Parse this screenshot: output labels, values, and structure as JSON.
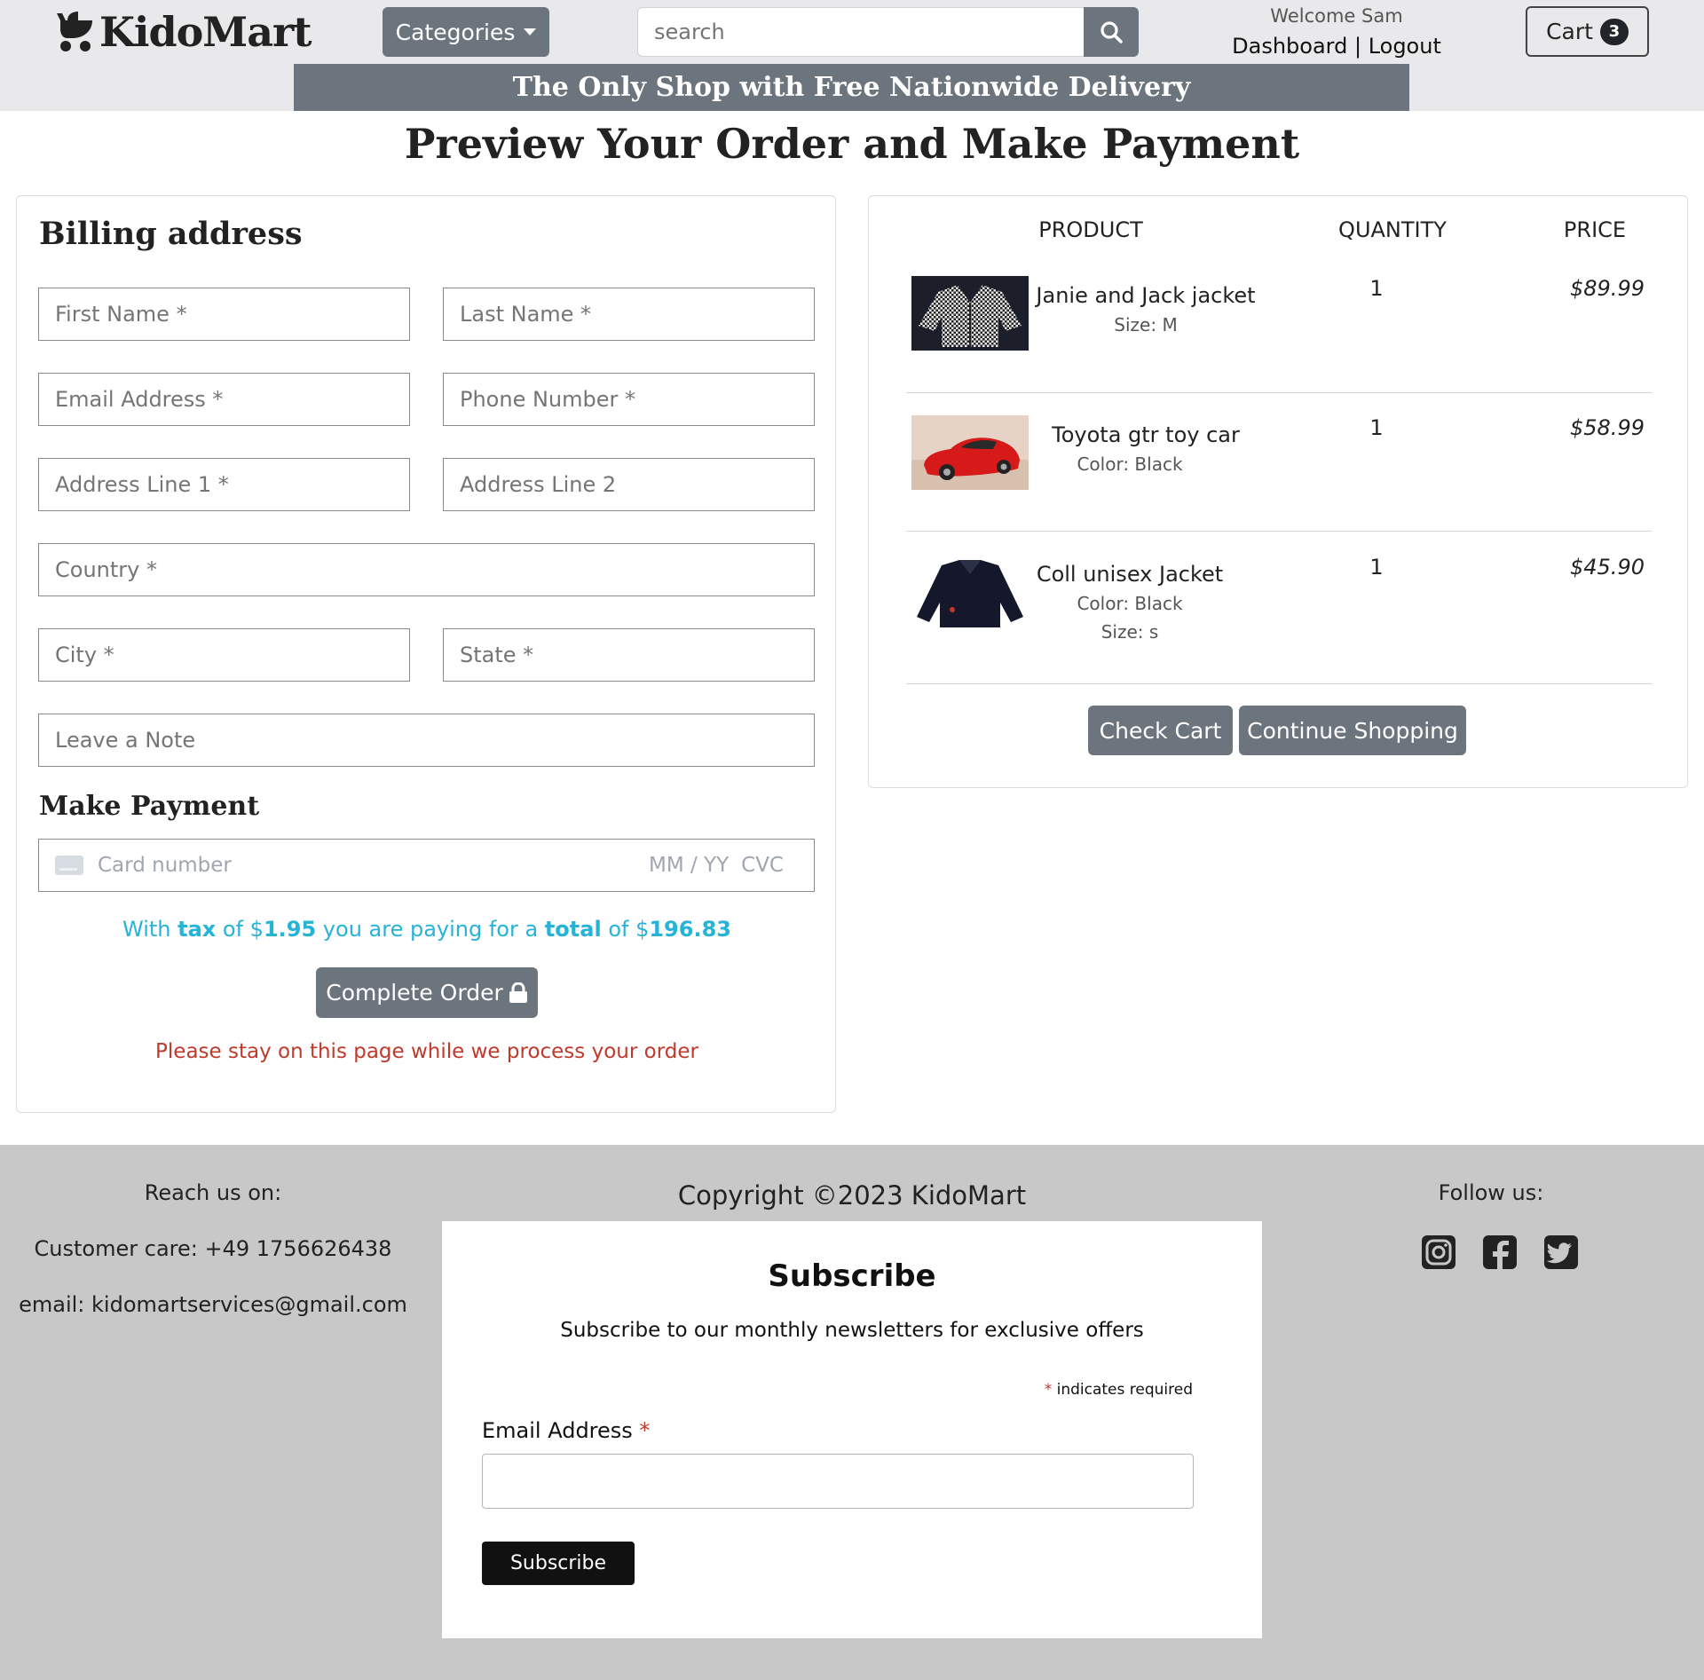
{
  "header": {
    "logo_text": "KidoMart",
    "categories_label": "Categories",
    "search_placeholder": "search",
    "welcome": "Welcome Sam",
    "dashboard_label": "Dashboard",
    "separator": " | ",
    "logout_label": "Logout",
    "cart_label": "Cart",
    "cart_count": "3",
    "banner": "The Only Shop with Free Nationwide Delivery"
  },
  "page_title": "Preview Your Order and Make Payment",
  "billing": {
    "title": "Billing address",
    "first_name": "First Name *",
    "last_name": "Last Name *",
    "email": "Email Address *",
    "phone": "Phone Number *",
    "address1": "Address Line 1 *",
    "address2": "Address Line 2",
    "country": "Country *",
    "city": "City *",
    "state": "State *",
    "note": "Leave a Note"
  },
  "payment": {
    "title": "Make Payment",
    "card_placeholder": "Card number",
    "exp_placeholder": "MM / YY",
    "cvc_placeholder": "CVC",
    "total_prefix": "With ",
    "tax_word": "tax",
    "tax_mid": " of $",
    "tax_amount": "1.95",
    "total_mid": " you are paying for a ",
    "total_word": "total",
    "total_mid2": " of $",
    "total_amount": "196.83",
    "complete_label": "Complete Order",
    "stay_message": "Please stay on this page while we process your order"
  },
  "cart": {
    "headers": {
      "product": "PRODUCT",
      "quantity": "QUANTITY",
      "price": "PRICE"
    },
    "items": [
      {
        "name": "Janie and Jack jacket",
        "attrs": [
          "Size: M"
        ],
        "qty": "1",
        "price": "$89.99"
      },
      {
        "name": "Toyota gtr toy car",
        "attrs": [
          "Color: Black"
        ],
        "qty": "1",
        "price": "$58.99"
      },
      {
        "name": "Coll unisex Jacket",
        "attrs": [
          "Color: Black",
          "Size: s"
        ],
        "qty": "1",
        "price": "$45.90"
      }
    ],
    "check_cart_label": "Check Cart",
    "continue_label": "Continue Shopping"
  },
  "footer": {
    "reach_us": "Reach us on:",
    "customer_care": "Customer care: +49 1756626438",
    "email": "email: kidomartservices@gmail.com",
    "copyright": "Copyright ©2023 KidoMart",
    "follow_us": "Follow us:",
    "subscribe": {
      "title": "Subscribe",
      "text": "Subscribe to our monthly newsletters for exclusive offers",
      "required_star": "*",
      "required_note": " indicates required",
      "email_label": "Email Address ",
      "email_star": "*",
      "button": "Subscribe"
    }
  },
  "colors": {
    "accent_gray": "#6c757d",
    "info_cyan": "#26b3d8",
    "danger_red": "#c0392b",
    "footer_bg": "#c8c8c8"
  },
  "icons": [
    "stroller-icon",
    "search-icon",
    "caret-down-icon",
    "lock-icon",
    "credit-card-icon",
    "instagram-icon",
    "facebook-icon",
    "twitter-icon"
  ]
}
